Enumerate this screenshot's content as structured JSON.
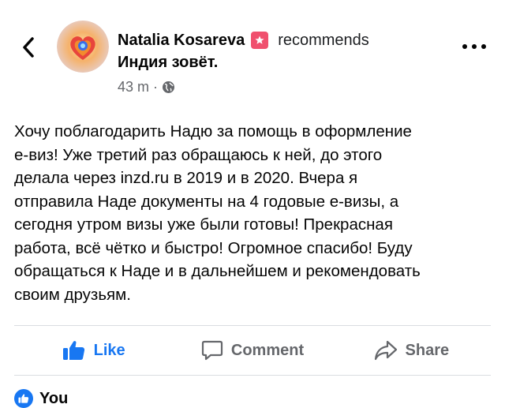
{
  "header": {
    "author": "Natalia Kosareva",
    "action": "recommends",
    "page_name": "Индия зовёт.",
    "time": "43 m",
    "separator": "·"
  },
  "post": {
    "text": "Хочу поблагодарить Надю за помощь в оформление\nе-виз! Уже третий раз обращаюсь к ней, до этого\nделала через inzd.ru в 2019 и в 2020. Вчера я\nотправила Наде документы на 4 годовые е-визы, а\nсегодня утром визы уже были готовы! Прекрасная\nработа, всё чётко и быстро! Огромное спасибо! Буду\nобращаться к Наде и в дальнейшем и рекомендовать\nсвоим друзьям."
  },
  "actions": {
    "like": "Like",
    "comment": "Comment",
    "share": "Share"
  },
  "reactions": {
    "label": "You"
  },
  "colors": {
    "accent": "#1877f2",
    "badge": "#f0506e",
    "secondary_text": "#65676b"
  },
  "icons": [
    "back-icon",
    "avatar",
    "recommend-badge-icon",
    "globe-icon",
    "more-icon",
    "like-icon",
    "comment-icon",
    "share-icon"
  ]
}
